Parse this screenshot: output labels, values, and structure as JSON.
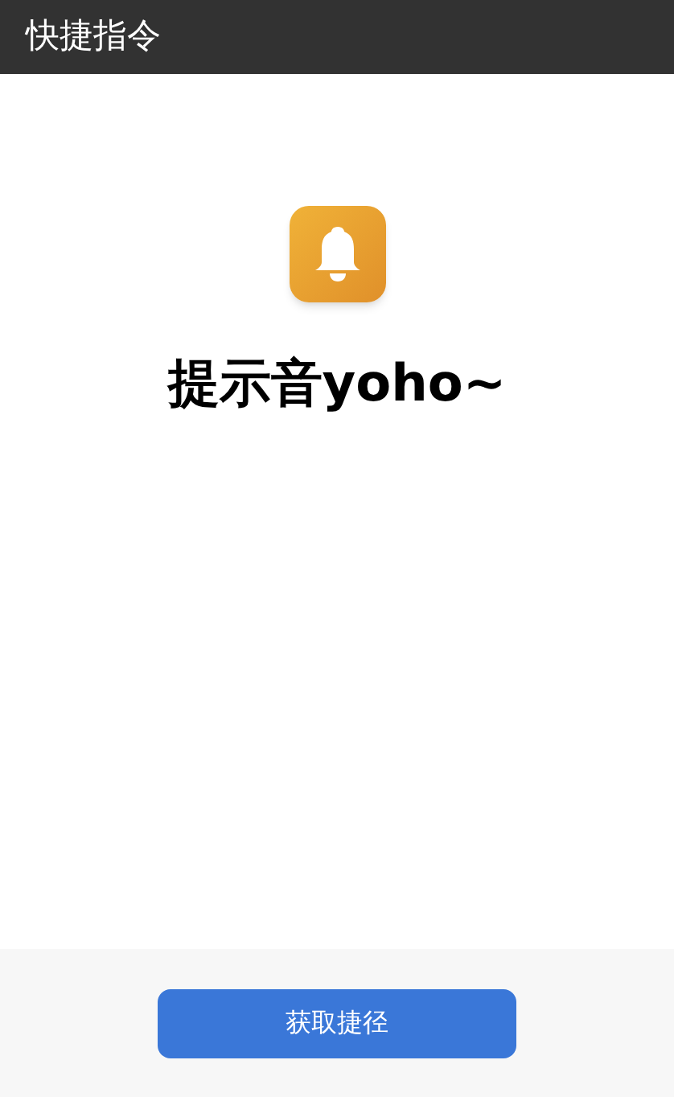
{
  "header": {
    "title": "快捷指令"
  },
  "shortcut": {
    "name": "提示音yoho~"
  },
  "footer": {
    "button": "获取捷径"
  }
}
